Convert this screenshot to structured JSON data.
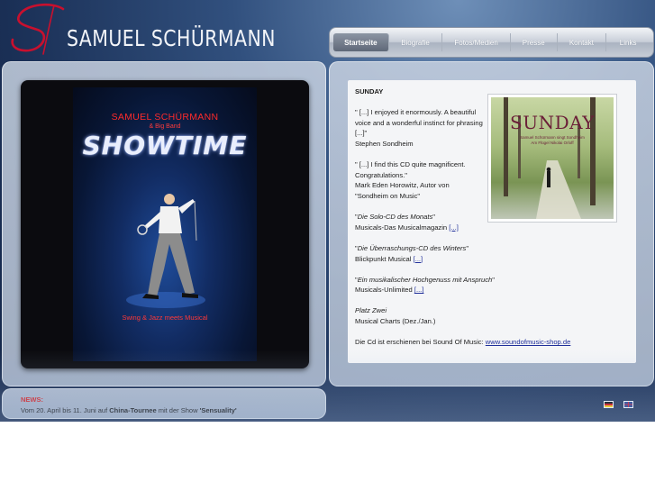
{
  "site": {
    "name": "SAMUEL SCHÜRMANN"
  },
  "nav": {
    "items": [
      {
        "label": "Startseite",
        "active": true
      },
      {
        "label": "Biografie",
        "active": false
      },
      {
        "label": "Fotos/Medien",
        "active": false
      },
      {
        "label": "Presse",
        "active": false
      },
      {
        "label": "Kontakt",
        "active": false
      },
      {
        "label": "Links",
        "active": false
      }
    ]
  },
  "poster": {
    "artist": "SAMUEL SCHÜRMANN",
    "band": "& Big Band",
    "title": "SHOWTIME",
    "tagline": "Swing & Jazz meets Musical"
  },
  "content": {
    "heading": "SUNDAY",
    "quote1": "\" [...] I enjoyed it enormously. A beautiful voice and a wonderful instinct for phrasing [...]\"",
    "quote1_author": "Stephen Sondheim",
    "quote2": "\" [...] I find this CD quite magnificent. Congratulations.\"",
    "quote2_author": "Mark Eden Horowitz, Autor von",
    "quote2_source": "\"Sondheim on Music\"",
    "review1_title": "Die Solo-CD des Monats",
    "review1_source": "Musicals-Das Musicalmagazin",
    "review2_title": "Die Überraschungs-CD des Winters",
    "review2_source": "Blickpunkt Musical",
    "review3_title": "Ein musikalischer Hochgenuss mit Anspruch",
    "review3_source": "Musicals-Unlimited",
    "review4_title": "Platz Zwei",
    "review4_source": "Musical Charts (Dez./Jan.)",
    "more_link": "[...]",
    "footer_text": "Die Cd ist erschienen bei Sound Of Music: ",
    "footer_link": "www.soundofmusic-shop.de"
  },
  "cover": {
    "title": "SUNDAY",
    "line1": "Samuel Schürmann singt Sondheim",
    "line2": "Am Flügel Nikolai Orloff"
  },
  "news": {
    "label": "NEWS:",
    "prefix": "Vom 20. April bis 11. Juni auf ",
    "tour": "China-Tournee",
    "middle": " mit der Show ",
    "show": "'Sensuality'"
  },
  "flags": [
    "german-flag-icon",
    "english-flag-icon"
  ]
}
